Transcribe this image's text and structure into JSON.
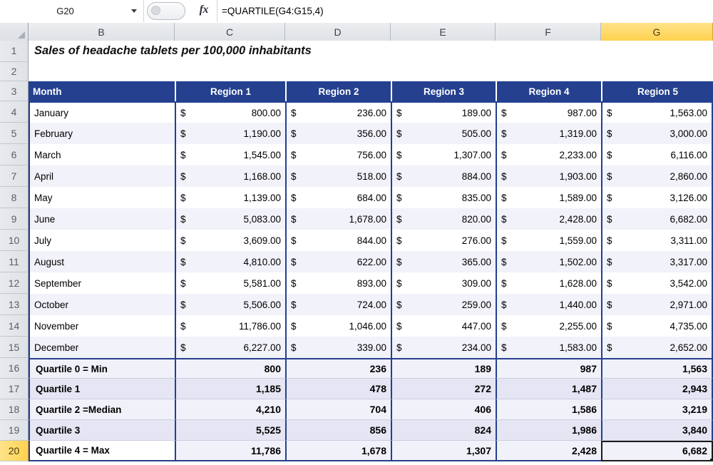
{
  "formula_bar": {
    "name_box_value": "G20",
    "formula_value": "=QUARTILE(G4:G15,4)",
    "fx_label": "fx",
    "dropdown_icon": "chevron-down-icon"
  },
  "column_headers": [
    "B",
    "C",
    "D",
    "E",
    "F",
    "G"
  ],
  "active_column": "G",
  "active_row": "20",
  "active_cell": "G20",
  "row_numbers": [
    "1",
    "2",
    "3",
    "4",
    "5",
    "6",
    "7",
    "8",
    "9",
    "10",
    "11",
    "12",
    "13",
    "14",
    "15",
    "16",
    "17",
    "18",
    "19",
    "20"
  ],
  "title": "Sales of headache tablets per 100,000 inhabitants",
  "table": {
    "headers": [
      "Month",
      "Region 1",
      "Region 2",
      "Region 3",
      "Region 4",
      "Region 5"
    ],
    "currency_symbol": "$",
    "rows": [
      {
        "month": "January",
        "values": [
          "800.00",
          "236.00",
          "189.00",
          "987.00",
          "1,563.00"
        ]
      },
      {
        "month": "February",
        "values": [
          "1,190.00",
          "356.00",
          "505.00",
          "1,319.00",
          "3,000.00"
        ]
      },
      {
        "month": "March",
        "values": [
          "1,545.00",
          "756.00",
          "1,307.00",
          "2,233.00",
          "6,116.00"
        ]
      },
      {
        "month": "April",
        "values": [
          "1,168.00",
          "518.00",
          "884.00",
          "1,903.00",
          "2,860.00"
        ]
      },
      {
        "month": "May",
        "values": [
          "1,139.00",
          "684.00",
          "835.00",
          "1,589.00",
          "3,126.00"
        ]
      },
      {
        "month": "June",
        "values": [
          "5,083.00",
          "1,678.00",
          "820.00",
          "2,428.00",
          "6,682.00"
        ]
      },
      {
        "month": "July",
        "values": [
          "3,609.00",
          "844.00",
          "276.00",
          "1,559.00",
          "3,311.00"
        ]
      },
      {
        "month": "August",
        "values": [
          "4,810.00",
          "622.00",
          "365.00",
          "1,502.00",
          "3,317.00"
        ]
      },
      {
        "month": "September",
        "values": [
          "5,581.00",
          "893.00",
          "309.00",
          "1,628.00",
          "3,542.00"
        ]
      },
      {
        "month": "October",
        "values": [
          "5,506.00",
          "724.00",
          "259.00",
          "1,440.00",
          "2,971.00"
        ]
      },
      {
        "month": "November",
        "values": [
          "11,786.00",
          "1,046.00",
          "447.00",
          "2,255.00",
          "4,735.00"
        ]
      },
      {
        "month": "December",
        "values": [
          "6,227.00",
          "339.00",
          "234.00",
          "1,583.00",
          "2,652.00"
        ]
      }
    ],
    "summary": [
      {
        "label": "Quartile 0 = Min",
        "values": [
          "800",
          "236",
          "189",
          "987",
          "1,563"
        ]
      },
      {
        "label": "Quartile 1",
        "values": [
          "1,185",
          "478",
          "272",
          "1,487",
          "2,943"
        ]
      },
      {
        "label": "Quartile 2 =Median",
        "values": [
          "4,210",
          "704",
          "406",
          "1,586",
          "3,219"
        ]
      },
      {
        "label": "Quartile 3",
        "values": [
          "5,525",
          "856",
          "824",
          "1,986",
          "3,840"
        ]
      },
      {
        "label": "Quartile 4 = Max",
        "values": [
          "11,786",
          "1,678",
          "1,307",
          "2,428",
          "6,682"
        ]
      }
    ]
  },
  "colors": {
    "header_blue": "#24408e",
    "active_header_gold": "#ffd24f",
    "row_alt": "#f2f2fa",
    "summary_alt": "#e5e5f3"
  }
}
